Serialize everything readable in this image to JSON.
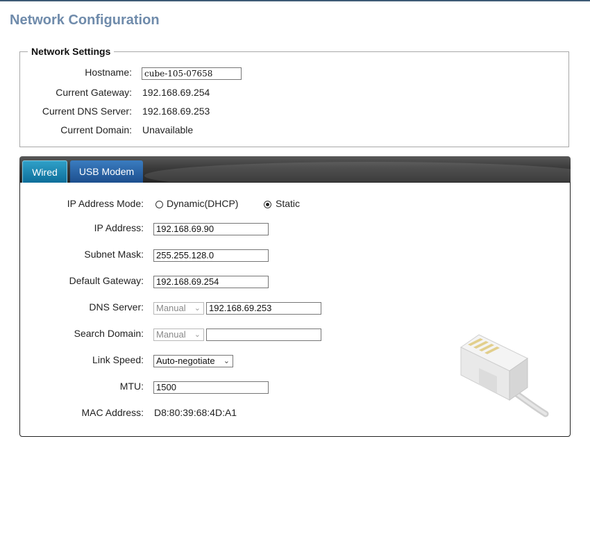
{
  "page": {
    "title": "Network Configuration"
  },
  "network_settings": {
    "legend": "Network Settings",
    "hostname": {
      "label": "Hostname:",
      "value": "cube-105-07658"
    },
    "gateway": {
      "label": "Current Gateway:",
      "value": "192.168.69.254"
    },
    "dns": {
      "label": "Current DNS Server:",
      "value": "192.168.69.253"
    },
    "domain": {
      "label": "Current Domain:",
      "value": "Unavailable"
    }
  },
  "tabs": [
    {
      "label": "Wired",
      "active": true
    },
    {
      "label": "USB Modem",
      "active": false
    }
  ],
  "wired": {
    "ip_mode": {
      "label": "IP Address Mode:",
      "options": [
        {
          "label": "Dynamic(DHCP)",
          "checked": false
        },
        {
          "label": "Static",
          "checked": true
        }
      ]
    },
    "ip_address": {
      "label": "IP Address:",
      "value": "192.168.69.90"
    },
    "subnet_mask": {
      "label": "Subnet Mask:",
      "value": "255.255.128.0"
    },
    "default_gateway": {
      "label": "Default Gateway:",
      "value": "192.168.69.254"
    },
    "dns_server": {
      "label": "DNS Server:",
      "mode": "Manual",
      "value": "192.168.69.253"
    },
    "search_domain": {
      "label": "Search Domain:",
      "mode": "Manual",
      "value": ""
    },
    "link_speed": {
      "label": "Link Speed:",
      "value": "Auto-negotiate"
    },
    "mtu": {
      "label": "MTU:",
      "value": "1500"
    },
    "mac_address": {
      "label": "MAC Address:",
      "value": "D8:80:39:68:4D:A1"
    }
  },
  "icons": {
    "network": "ethernet-plug-icon",
    "dropdown": "chevron-down-icon"
  },
  "colors": {
    "title": "#6f8bab",
    "tab_active": "#1f86b5",
    "tab_inactive": "#2b64a6"
  }
}
